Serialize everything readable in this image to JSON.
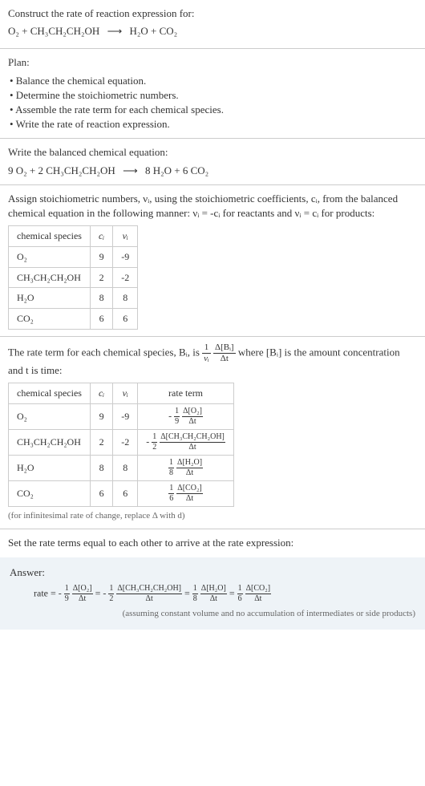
{
  "title": "Construct the rate of reaction expression for:",
  "initial_equation": {
    "lhs": "O₂ + CH₃CH₂CH₂OH",
    "arrow": "⟶",
    "rhs": "H₂O + CO₂"
  },
  "plan_label": "Plan:",
  "plan_items": [
    "• Balance the chemical equation.",
    "• Determine the stoichiometric numbers.",
    "• Assemble the rate term for each chemical species.",
    "• Write the rate of reaction expression."
  ],
  "balanced_label": "Write the balanced chemical equation:",
  "balanced_equation": {
    "lhs": "9 O₂ + 2 CH₃CH₂CH₂OH",
    "arrow": "⟶",
    "rhs": "8 H₂O + 6 CO₂"
  },
  "stoich_text_1": "Assign stoichiometric numbers, νᵢ, using the stoichiometric coefficients, cᵢ, from the balanced chemical equation in the following manner: νᵢ = -cᵢ for reactants and νᵢ = cᵢ for products:",
  "table1": {
    "headers": [
      "chemical species",
      "cᵢ",
      "νᵢ"
    ],
    "rows": [
      [
        "O₂",
        "9",
        "-9"
      ],
      [
        "CH₃CH₂CH₂OH",
        "2",
        "-2"
      ],
      [
        "H₂O",
        "8",
        "8"
      ],
      [
        "CO₂",
        "6",
        "6"
      ]
    ]
  },
  "rate_term_text_1": "The rate term for each chemical species, Bᵢ, is",
  "rate_term_text_2": "where [Bᵢ] is the amount concentration and t is time:",
  "rate_frac_main": {
    "num1": "1",
    "den1": "νᵢ",
    "num2": "Δ[Bᵢ]",
    "den2": "Δt"
  },
  "table2": {
    "headers": [
      "chemical species",
      "cᵢ",
      "νᵢ",
      "rate term"
    ],
    "rows": [
      {
        "species": "O₂",
        "c": "9",
        "v": "-9",
        "sign": "-",
        "coef_num": "1",
        "coef_den": "9",
        "delta_num": "Δ[O₂]",
        "delta_den": "Δt"
      },
      {
        "species": "CH₃CH₂CH₂OH",
        "c": "2",
        "v": "-2",
        "sign": "-",
        "coef_num": "1",
        "coef_den": "2",
        "delta_num": "Δ[CH₃CH₂CH₂OH]",
        "delta_den": "Δt"
      },
      {
        "species": "H₂O",
        "c": "8",
        "v": "8",
        "sign": "",
        "coef_num": "1",
        "coef_den": "8",
        "delta_num": "Δ[H₂O]",
        "delta_den": "Δt"
      },
      {
        "species": "CO₂",
        "c": "6",
        "v": "6",
        "sign": "",
        "coef_num": "1",
        "coef_den": "6",
        "delta_num": "Δ[CO₂]",
        "delta_den": "Δt"
      }
    ]
  },
  "infinitesimal_note": "(for infinitesimal rate of change, replace Δ with d)",
  "final_text": "Set the rate terms equal to each other to arrive at the rate expression:",
  "answer_label": "Answer:",
  "answer_terms": [
    {
      "prefix": "rate = -",
      "cn": "1",
      "cd": "9",
      "dn": "Δ[O₂]",
      "dd": "Δt"
    },
    {
      "prefix": " = -",
      "cn": "1",
      "cd": "2",
      "dn": "Δ[CH₃CH₂CH₂OH]",
      "dd": "Δt"
    },
    {
      "prefix": " = ",
      "cn": "1",
      "cd": "8",
      "dn": "Δ[H₂O]",
      "dd": "Δt"
    },
    {
      "prefix": " = ",
      "cn": "1",
      "cd": "6",
      "dn": "Δ[CO₂]",
      "dd": "Δt"
    }
  ],
  "answer_note": "(assuming constant volume and no accumulation of intermediates or side products)"
}
